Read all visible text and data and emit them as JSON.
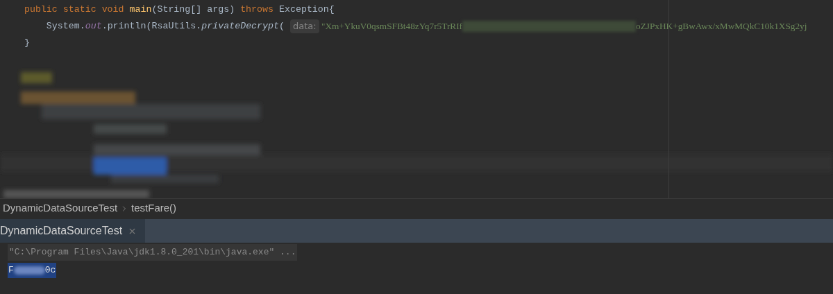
{
  "editor": {
    "lines": [
      {
        "tokens": [
          {
            "kind": "keyword",
            "text": "    public static void "
          },
          {
            "kind": "method",
            "text": "main"
          },
          {
            "kind": "plain",
            "text": "(String[] args) "
          },
          {
            "kind": "keyword",
            "text": "throws "
          },
          {
            "kind": "plain",
            "text": "Exception{"
          }
        ]
      },
      {
        "tokens": [
          {
            "kind": "plain",
            "text": "        System."
          },
          {
            "kind": "field",
            "text": "out"
          },
          {
            "kind": "plain",
            "text": ".println(RsaUtils."
          },
          {
            "kind": "call",
            "text": "privateDecrypt"
          },
          {
            "kind": "plain",
            "text": "( "
          },
          {
            "kind": "hint",
            "text": "data:"
          },
          {
            "kind": "string",
            "text": " \"Xm+YkuV0qsmSFBt48zYq7r5TrRIf"
          },
          {
            "kind": "redacted"
          },
          {
            "kind": "string",
            "text": "oZJPxHK+gBwAwx/xMwMQkC10k1XSg2yj"
          }
        ]
      },
      {
        "tokens": [
          {
            "kind": "plain",
            "text": "    }"
          }
        ]
      }
    ]
  },
  "breadcrumb": [
    "DynamicDataSourceTest",
    "testFare()"
  ],
  "run_tabs": [
    {
      "label": "DynamicDataSourceTest",
      "selected": true
    }
  ],
  "console": [
    {
      "kind": "command",
      "text": "\"C:\\Program Files\\Java\\jdk1.8.0_201\\bin\\java.exe\" ..."
    },
    {
      "kind": "output",
      "selected": true,
      "start": "F",
      "end": "0c"
    }
  ]
}
